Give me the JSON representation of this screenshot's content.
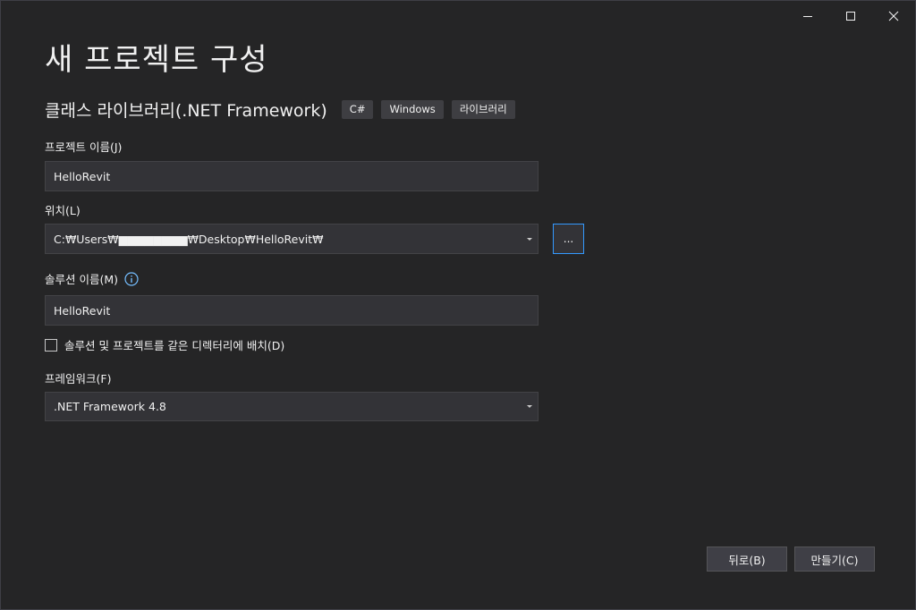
{
  "dialog": {
    "title": "새 프로젝트 구성",
    "template_name": "클래스 라이브러리(.NET Framework)",
    "tags": [
      "C#",
      "Windows",
      "라이브러리"
    ]
  },
  "project_name": {
    "label": "프로젝트 이름(J)",
    "value": "HelloRevit"
  },
  "location": {
    "label": "위치(L)",
    "value": "C:₩Users₩▆▆▆▆▆▆▆▆₩Desktop₩HelloRevit₩",
    "browse_label": "..."
  },
  "solution_name": {
    "label": "솔루션 이름(M)",
    "value": "HelloRevit",
    "info_icon": "info-icon"
  },
  "same_directory": {
    "label": "솔루션 및 프로젝트를 같은 디렉터리에 배치(D)",
    "checked": false
  },
  "framework": {
    "label": "프레임워크(F)",
    "selected": ".NET Framework 4.8"
  },
  "buttons": {
    "back": "뒤로(B)",
    "create": "만들기(C)"
  },
  "colors": {
    "background": "#252526",
    "field": "#333337",
    "accent": "#3399ff",
    "info": "#75beff"
  }
}
